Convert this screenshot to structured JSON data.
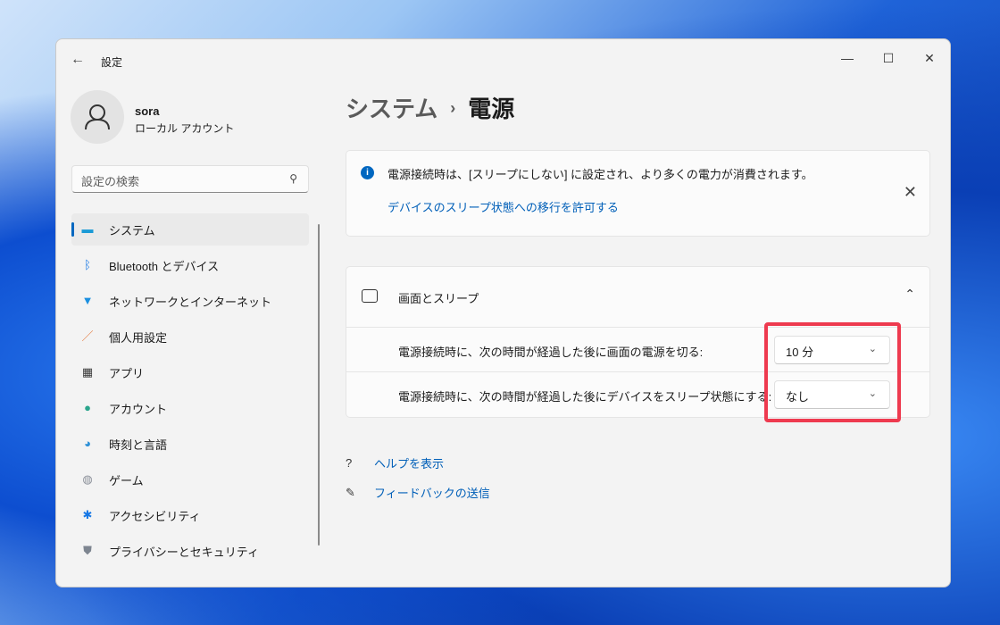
{
  "window": {
    "title": "設定",
    "controls": {
      "minimize": "—",
      "maximize": "☐",
      "close": "✕"
    }
  },
  "user": {
    "name": "sora",
    "type": "ローカル アカウント"
  },
  "search": {
    "placeholder": "設定の検索"
  },
  "nav": [
    {
      "label": "システム",
      "icon": "display-icon",
      "glyph": "▬",
      "color": "#1a9ad6",
      "selected": true
    },
    {
      "label": "Bluetooth とデバイス",
      "icon": "bluetooth-icon",
      "glyph": "ᛒ",
      "color": "#1677e5"
    },
    {
      "label": "ネットワークとインターネット",
      "icon": "wifi-icon",
      "glyph": "▼",
      "color": "#1a8fe0"
    },
    {
      "label": "個人用設定",
      "icon": "brush-icon",
      "glyph": "／",
      "color": "#e3793c"
    },
    {
      "label": "アプリ",
      "icon": "apps-icon",
      "glyph": "▦",
      "color": "#3a3a3a"
    },
    {
      "label": "アカウント",
      "icon": "person-icon",
      "glyph": "●",
      "color": "#2aa58c"
    },
    {
      "label": "時刻と言語",
      "icon": "clock-globe-icon",
      "glyph": "◕",
      "color": "#2b8fd6"
    },
    {
      "label": "ゲーム",
      "icon": "gamepad-icon",
      "glyph": "◍",
      "color": "#8a8f99"
    },
    {
      "label": "アクセシビリティ",
      "icon": "accessibility-icon",
      "glyph": "✱",
      "color": "#1677e5"
    },
    {
      "label": "プライバシーとセキュリティ",
      "icon": "shield-icon",
      "glyph": "⛊",
      "color": "#7d8590"
    }
  ],
  "breadcrumb": {
    "parent": "システム",
    "separator": "›",
    "current": "電源"
  },
  "info": {
    "text": "電源接続時は、[スリープにしない] に設定され、より多くの電力が消費されます。",
    "link": "デバイスのスリープ状態への移行を許可する"
  },
  "sleep": {
    "title": "画面とスリープ",
    "rows": [
      {
        "label": "電源接続時に、次の時間が経過した後に画面の電源を切る:",
        "value": "10 分"
      },
      {
        "label": "電源接続時に、次の時間が経過した後にデバイスをスリープ状態にする:",
        "value": "なし"
      }
    ]
  },
  "links": {
    "help": "ヘルプを表示",
    "feedback": "フィードバックの送信"
  },
  "colors": {
    "accent": "#0067c0",
    "highlight": "#ee3a4f"
  }
}
